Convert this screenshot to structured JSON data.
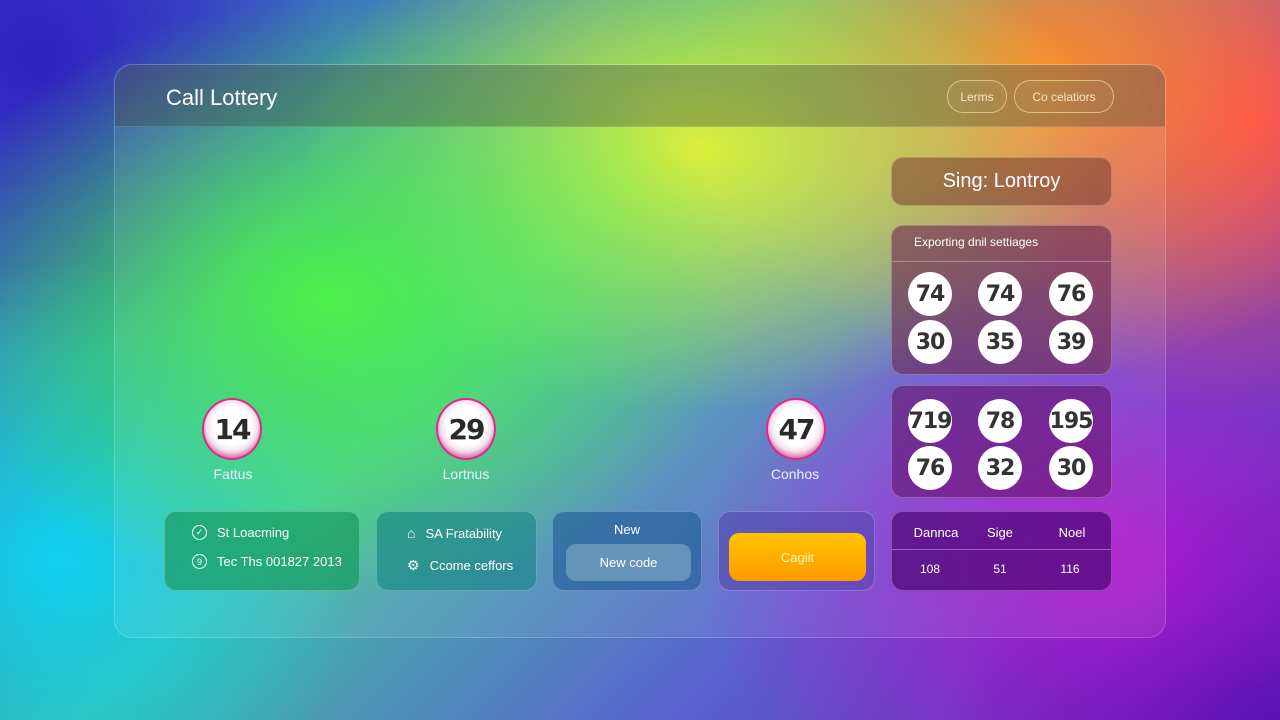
{
  "header": {
    "title": "Call Lottery",
    "buttons": [
      "Lerms",
      "Co celatiors"
    ]
  },
  "draw_card": {
    "title": "Sing: Lontroy"
  },
  "settings": {
    "label": "Exporting dnil settiages",
    "numbers": [
      "74",
      "74",
      "76",
      "30",
      "35",
      "39"
    ]
  },
  "second_set": {
    "numbers": [
      "719",
      "78",
      "195",
      "76",
      "32",
      "30"
    ]
  },
  "stats": {
    "headers": [
      "Dannca",
      "Sige",
      "Noel"
    ],
    "values": [
      "108",
      "51",
      "116"
    ]
  },
  "featured": [
    {
      "number": "14",
      "label": "Fattus"
    },
    {
      "number": "29",
      "label": "Lortnus"
    },
    {
      "number": "47",
      "label": "Conhos"
    }
  ],
  "info_card": {
    "items": [
      {
        "icon": "check-shield-icon",
        "text": "St Loacming"
      },
      {
        "icon": "clock-icon",
        "text": "Tec Ths 001827 2013"
      }
    ]
  },
  "feature_card": {
    "items": [
      {
        "icon": "home-icon",
        "text": "SA Fratability"
      },
      {
        "icon": "gear-icon",
        "text": "Ccome ceffors"
      }
    ]
  },
  "code_card": {
    "label": "New",
    "button": "New code"
  },
  "action": {
    "button": "Cagiit",
    "color": "#ffb000"
  }
}
